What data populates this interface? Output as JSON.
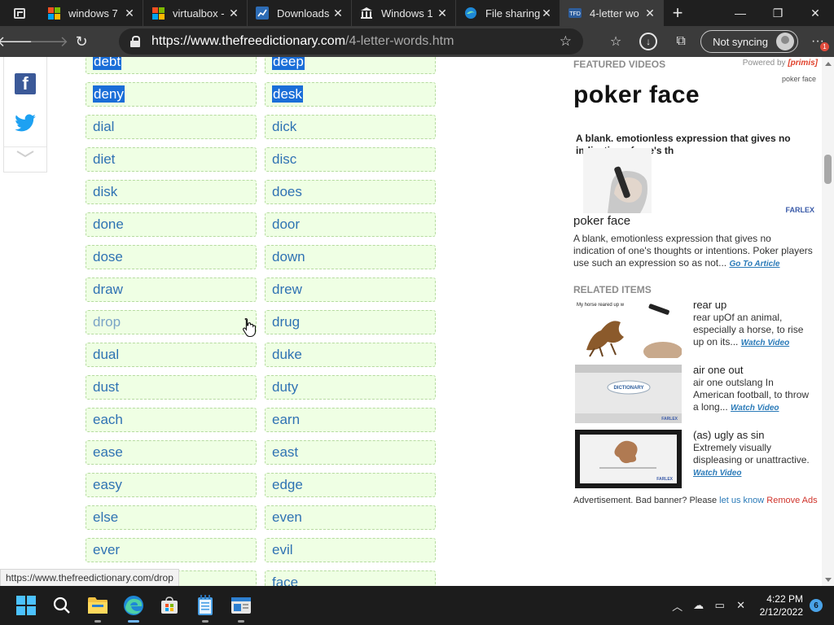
{
  "browser": {
    "tabs": [
      {
        "title": "windows 7",
        "icon": "microsoft-logo"
      },
      {
        "title": "virtualbox -",
        "icon": "microsoft-logo"
      },
      {
        "title": "Downloads",
        "icon": "chart-icon"
      },
      {
        "title": "Windows 1",
        "icon": "library-icon"
      },
      {
        "title": "File sharing",
        "icon": "edge-icon"
      },
      {
        "title": "4-letter wo",
        "icon": "tfd-icon",
        "active": true
      }
    ],
    "new_tab": "+",
    "url_host": "https://www.thefreedictionary.com",
    "url_path": "/4-letter-words.htm",
    "sync_label": "Not syncing",
    "notification_count": "1"
  },
  "words": {
    "left": [
      "debt",
      "deny",
      "dial",
      "diet",
      "disk",
      "done",
      "dose",
      "draw",
      "drop",
      "dual",
      "dust",
      "each",
      "ease",
      "easy",
      "else",
      "ever"
    ],
    "right": [
      "deep",
      "desk",
      "dick",
      "disc",
      "does",
      "door",
      "down",
      "drew",
      "drug",
      "duke",
      "duty",
      "earn",
      "east",
      "edge",
      "even",
      "evil",
      "face"
    ]
  },
  "sidebar": {
    "featured_label": "FEATURED VIDEOS",
    "powered_by": "Powered by",
    "powered_brand": "[primis]",
    "video_caption": "poker face",
    "video_title": "poker face",
    "video_text": "A blank. emotionless expression that gives no indication of one's th",
    "farlex": "FARLEX",
    "item_title": "poker face",
    "item_desc": "A blank, emotionless expression that gives no indication of one's thoughts or intentions. Poker players use such an expression so as not...",
    "go_to_article": "Go To Article",
    "related_label": "RELATED ITEMS",
    "related": [
      {
        "title": "rear up",
        "desc": "rear upOf an animal, especially a horse, to rise up on its...",
        "link": "Watch Video",
        "thumb_text": "My horse reared up w"
      },
      {
        "title": "air one out",
        "desc": "air one outslang In American football, to throw a long...",
        "link": "Watch Video",
        "thumb_text": "DICTIONARY"
      },
      {
        "title": "(as) ugly as sin",
        "desc": "Extremely visually displeasing or unattractive.",
        "link": "Watch Video",
        "thumb_text": ""
      }
    ],
    "ad_text": "Advertisement. Bad banner? Please",
    "ad_link": "let us know",
    "ad_remove": "Remove Ads"
  },
  "status_url": "https://www.thefreedictionary.com/drop",
  "taskbar": {
    "time": "4:22 PM",
    "date": "2/12/2022",
    "notifications": "6"
  }
}
